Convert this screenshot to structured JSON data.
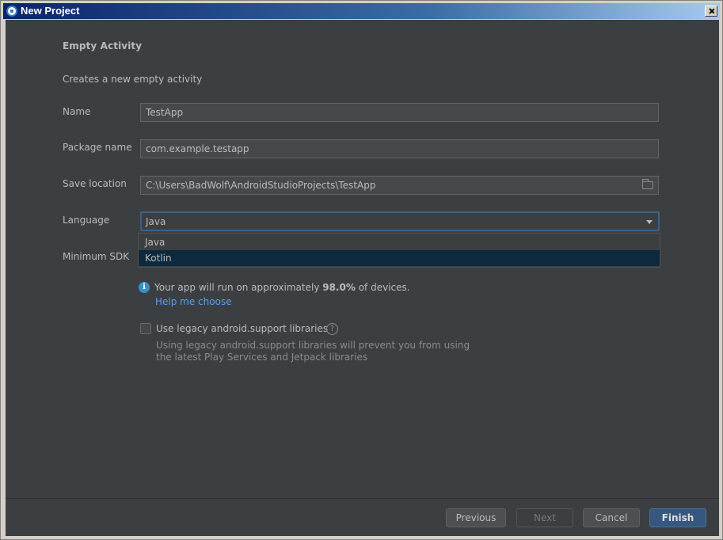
{
  "window": {
    "title": "New Project"
  },
  "template": {
    "heading": "Empty Activity",
    "description": "Creates a new empty activity"
  },
  "form": {
    "name_label": "Name",
    "name_value": "TestApp",
    "package_label": "Package name",
    "package_value": "com.example.testapp",
    "save_label": "Save location",
    "save_value": "C:\\Users\\BadWolf\\AndroidStudioProjects\\TestApp",
    "language_label": "Language",
    "language_value": "Java",
    "language_options": [
      "Java",
      "Kotlin"
    ],
    "min_sdk_label": "Minimum SDK"
  },
  "info": {
    "prefix": "Your app will run on approximately ",
    "percent": "98.0%",
    "suffix": " of devices.",
    "help_link": "Help me choose"
  },
  "legacy": {
    "checkbox_label": "Use legacy android.support libraries",
    "description_line1": "Using legacy android.support libraries will prevent you from using",
    "description_line2": "the latest Play Services and Jetpack libraries"
  },
  "buttons": {
    "previous": "Previous",
    "next": "Next",
    "cancel": "Cancel",
    "finish": "Finish"
  },
  "colors": {
    "background": "#3c3f41",
    "accent": "#365880",
    "link": "#589df6",
    "selection": "#0d293e"
  },
  "icons": {
    "title": "android-studio-icon",
    "close": "close-icon",
    "folder": "folder-icon",
    "dropdown": "chevron-down-icon",
    "info": "info-icon",
    "help": "question-icon"
  }
}
